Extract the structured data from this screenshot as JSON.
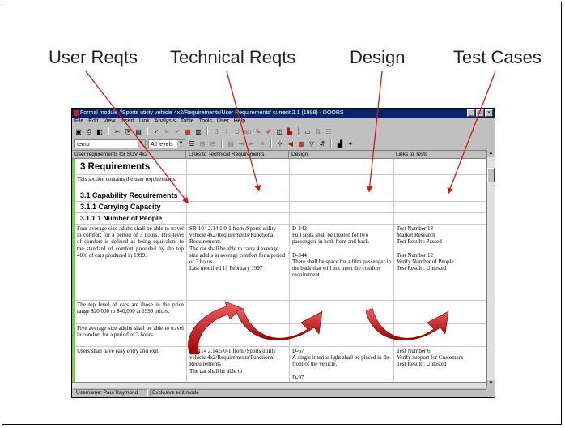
{
  "slide": {
    "labels": [
      "User Reqts",
      "Technical Reqts",
      "Design",
      "Test Cases"
    ]
  },
  "window": {
    "title": "Formal module '/Sports utility vehicle 4x2/Requirements/User Requirements' current 2.1 (1998) - DOORS",
    "menu": [
      "File",
      "Edit",
      "View",
      "Insert",
      "Link",
      "Analysis",
      "Table",
      "Tools",
      "User",
      "Help"
    ],
    "view_combo": "temp",
    "level_combo": "All levels",
    "columns": [
      "User requirements for SUV 4x2",
      "Links to Technical Requirements",
      "Design",
      "Links to Tests"
    ]
  },
  "rows": {
    "heading_3": "3 Requirements",
    "intro": "This section contains the user requirements.",
    "heading_31": "3.1 Capability Requirements",
    "heading_311": "3.1.1 Carrying Capacity",
    "heading_3111": "3.1.1.1 Number of People",
    "req1_user": "Four average size adults shall be able to travel in comfort for a period of 3 hours. This level of comfort is defined as being equivalent to the standard of comfort provided by the top 40% of cars produced in 1999.",
    "req1_tech": "SR-104 2.14.1.0-1 from /Sports utility vehicle 4x2/Requirements/Functional Requirements\nThe car shall be able to carry 4 average size adults in average comfort for a period of 3 hours.\nLast modified 11 February 1997",
    "req1_design": "D-342\nFull seats shall be created for two passengers in both front and back.\n\nD-344\nThere shall be space for a fifth passenger in the back that will not meet the comfort requirement.",
    "req1_tests": "Test Number 18\nMarket Research\nTest Result : Passed\n\nTest Number 12\nVerify Number of People\nTest Result : Untested",
    "req2_user": "The top level of cars are those in the price range $20,000 to $40,000 at 1999 prices.",
    "req3_user": "Five average size adults shall be able to travel in comfort for a period of 3 hours.",
    "req4_user": "Users shall have easy entry and exit.",
    "req4_tech": "SR-114 2.14.5.0-1 from /Sports utility vehicle 4x2/Requirements/Functional Requirements\nThe car shall be able to",
    "req4_design": "D-67\nA single interior light shall be placed in the front of the vehicle.\n\nD-97",
    "req4_tests": "Test Number 6\nVerify support for Customers\nTest Result : Untested"
  },
  "status": {
    "user": "Username: Paul Raymond",
    "mode": "Exclusive edit mode"
  },
  "colors": {
    "title_bar": "#0a246a",
    "left_bar": "#7ec84a",
    "arrow_red": "#d01818"
  }
}
